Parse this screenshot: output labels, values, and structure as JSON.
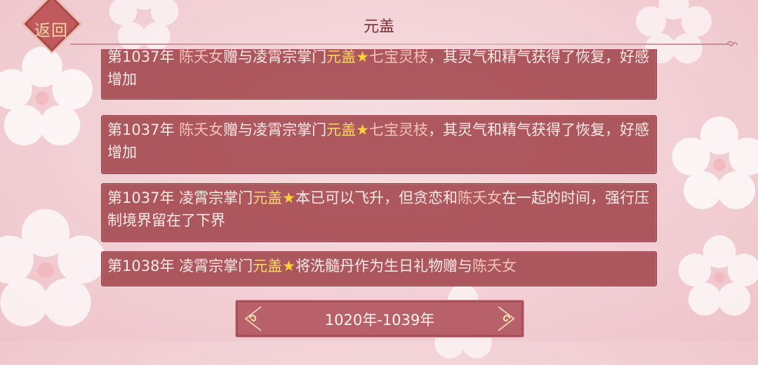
{
  "header": {
    "title": "元盖",
    "back_label": "返回"
  },
  "records": [
    {
      "year": "第1037年",
      "parts": [
        {
          "t": "陈夭女",
          "c": "name"
        },
        {
          "t": "赠与凌霄宗掌门",
          "c": "text"
        },
        {
          "t": "元盖",
          "c": "gold"
        },
        {
          "t": "★",
          "c": "star"
        },
        {
          "t": "七宝灵枝",
          "c": "name"
        },
        {
          "t": "，其灵气和精气获得了恢复，好感增加",
          "c": "text"
        }
      ]
    },
    {
      "year": "第1037年",
      "parts": [
        {
          "t": "陈夭女",
          "c": "name"
        },
        {
          "t": "赠与凌霄宗掌门",
          "c": "text"
        },
        {
          "t": "元盖",
          "c": "gold"
        },
        {
          "t": "★",
          "c": "star"
        },
        {
          "t": "七宝灵枝",
          "c": "name"
        },
        {
          "t": "，其灵气和精气获得了恢复，好感增加",
          "c": "text"
        }
      ]
    },
    {
      "year": "第1037年",
      "parts": [
        {
          "t": "凌霄宗掌门",
          "c": "text"
        },
        {
          "t": "元盖",
          "c": "gold"
        },
        {
          "t": "★",
          "c": "star"
        },
        {
          "t": "本已可以飞升，但贪恋和",
          "c": "text"
        },
        {
          "t": "陈夭女",
          "c": "name"
        },
        {
          "t": "在一起的时间，强行压制境界留在了下界",
          "c": "text"
        }
      ]
    },
    {
      "year": "第1038年",
      "parts": [
        {
          "t": "凌霄宗掌门",
          "c": "text"
        },
        {
          "t": "元盖",
          "c": "gold"
        },
        {
          "t": "★",
          "c": "star"
        },
        {
          "t": "将洗髓丹作为生日礼物赠与",
          "c": "text"
        },
        {
          "t": "陈夭女",
          "c": "name"
        }
      ]
    }
  ],
  "footer": {
    "range_label": "1020年-1039年"
  },
  "icons": {
    "back": "diamond-back-icon",
    "background": "plum-blossom-icon",
    "ornament": "cloud-scroll-icon"
  },
  "colors": {
    "card": "#a64c52",
    "gold_highlight": "#ffd86e",
    "name_highlight": "#f6c3b8"
  }
}
